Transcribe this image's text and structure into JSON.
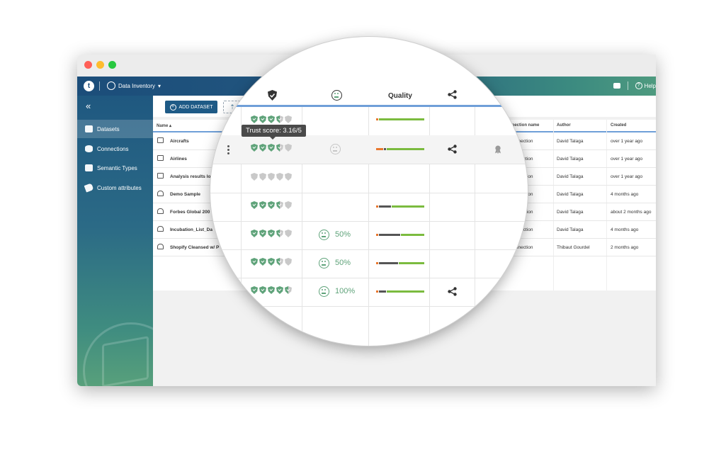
{
  "app": {
    "title": "Data Inventory",
    "logo_letter": "t",
    "help_label": "Help"
  },
  "sidebar": {
    "items": [
      {
        "label": "Datasets",
        "icon": "dataset-icon",
        "active": true
      },
      {
        "label": "Connections",
        "icon": "database-icon",
        "active": false
      },
      {
        "label": "Semantic Types",
        "icon": "semantic-type-icon",
        "active": false
      },
      {
        "label": "Custom attributes",
        "icon": "tag-icon",
        "active": false
      }
    ]
  },
  "toolbar": {
    "add_dataset_label": "ADD DATASET"
  },
  "table": {
    "headers": {
      "name": "Name ▴",
      "connection": "Connection name",
      "author": "Author",
      "created": "Created"
    },
    "rows": [
      {
        "name": "Aircrafts",
        "connection": "connection",
        "author": "David Talaga",
        "created": "over 1 year ago",
        "type": "file"
      },
      {
        "name": "Airlines",
        "connection": "connection",
        "author": "David Talaga",
        "created": "over 1 year ago",
        "type": "file"
      },
      {
        "name": "Analysis results lo",
        "connection": "connection",
        "author": "David Talaga",
        "created": "over 1 year ago",
        "type": "file"
      },
      {
        "name": "Demo Sample",
        "connection": "connection",
        "author": "David Talaga",
        "created": "4 months ago",
        "type": "preparation"
      },
      {
        "name": "Forbes Global 200",
        "connection": "connection",
        "author": "David Talaga",
        "created": "about 2 months ago",
        "type": "preparation"
      },
      {
        "name": "Incubation_List_Da",
        "connection": "connection",
        "author": "David Talaga",
        "created": "4 months ago",
        "type": "preparation"
      },
      {
        "name": "Shopify Cleansed w/ P",
        "connection": "connection",
        "author": "Thibaut Gourdel",
        "created": "2 months ago",
        "type": "preparation"
      }
    ]
  },
  "magnifier": {
    "quality_header": "Quality",
    "tooltip": "Trust score: 3.16/5",
    "rows": [
      {
        "trust": 3.5,
        "rating_pct": "",
        "quality": {
          "invalid": 0.05,
          "empty": 0,
          "valid": 0.95
        },
        "shared": false,
        "certified": false
      },
      {
        "trust": 3.16,
        "rating_pct": "",
        "quality": {
          "invalid": 0.15,
          "empty": 0.05,
          "valid": 0.8
        },
        "shared": true,
        "certified": true
      },
      {
        "trust": 0,
        "rating_pct": "",
        "quality": null,
        "shared": false,
        "certified": false
      },
      {
        "trust": 3.5,
        "rating_pct": "",
        "quality": {
          "invalid": 0.05,
          "empty": 0.25,
          "valid": 0.7
        },
        "shared": false,
        "certified": false
      },
      {
        "trust": 3.5,
        "rating_pct": "50%",
        "quality": {
          "invalid": 0.05,
          "empty": 0.45,
          "valid": 0.5
        },
        "shared": false,
        "certified": false
      },
      {
        "trust": 3.5,
        "rating_pct": "50%",
        "quality": {
          "invalid": 0.05,
          "empty": 0.4,
          "valid": 0.55
        },
        "shared": false,
        "certified": false
      },
      {
        "trust": 4.5,
        "rating_pct": "100%",
        "quality": {
          "invalid": 0.05,
          "empty": 0.15,
          "valid": 0.8
        },
        "shared": true,
        "certified": false
      }
    ]
  },
  "colors": {
    "accent": "#1e5a86",
    "trust_green": "#5fa37a",
    "quality_valid": "#7bbb3f",
    "quality_empty": "#555555",
    "quality_invalid": "#e8772e"
  }
}
